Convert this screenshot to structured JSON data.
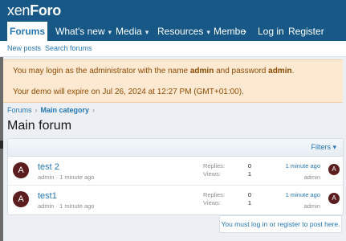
{
  "header": {
    "logo_prefix": "xen",
    "logo_brand": "Foro"
  },
  "nav": {
    "items": [
      {
        "label": "Forums"
      },
      {
        "label": "What's new"
      },
      {
        "label": "Media"
      },
      {
        "label": "Resources"
      },
      {
        "label": "Membe"
      }
    ],
    "login": "Log in",
    "register": "Register",
    "search_icon": "search-icon"
  },
  "subnav": {
    "new_posts": "New posts",
    "search_forums": "Search forums"
  },
  "notice": {
    "line1_pre": "You may login as the administrator with the name ",
    "user": "admin",
    "line1_mid": " and password ",
    "pass": "admin",
    "line1_end": ".",
    "line2": "Your demo will expire on Jul 26, 2024 at 12:27 PM (GMT+01:00)."
  },
  "breadcrumb": {
    "item1": "Forums",
    "item2": "Main category"
  },
  "page_title": "Main forum",
  "filters": "Filters",
  "stat_labels": {
    "replies": "Replies:",
    "views": "Views:"
  },
  "threads": [
    {
      "title": "test 2",
      "author": "admin",
      "age": "1 minute ago",
      "replies": "0",
      "views": "1",
      "last_time": "1 minute ago",
      "last_user": "admin",
      "avatar_letter": "A"
    },
    {
      "title": "test1",
      "author": "admin",
      "age": "1 minute ago",
      "replies": "0",
      "views": "1",
      "last_time": "1 minute ago",
      "last_user": "admin",
      "avatar_letter": "A"
    }
  ],
  "login_note": "You must log in or register to post here.",
  "colors": {
    "brand": "#185886",
    "link": "#2577b1",
    "notice_bg": "#fde9d2",
    "notice_text": "#8d4b00"
  }
}
